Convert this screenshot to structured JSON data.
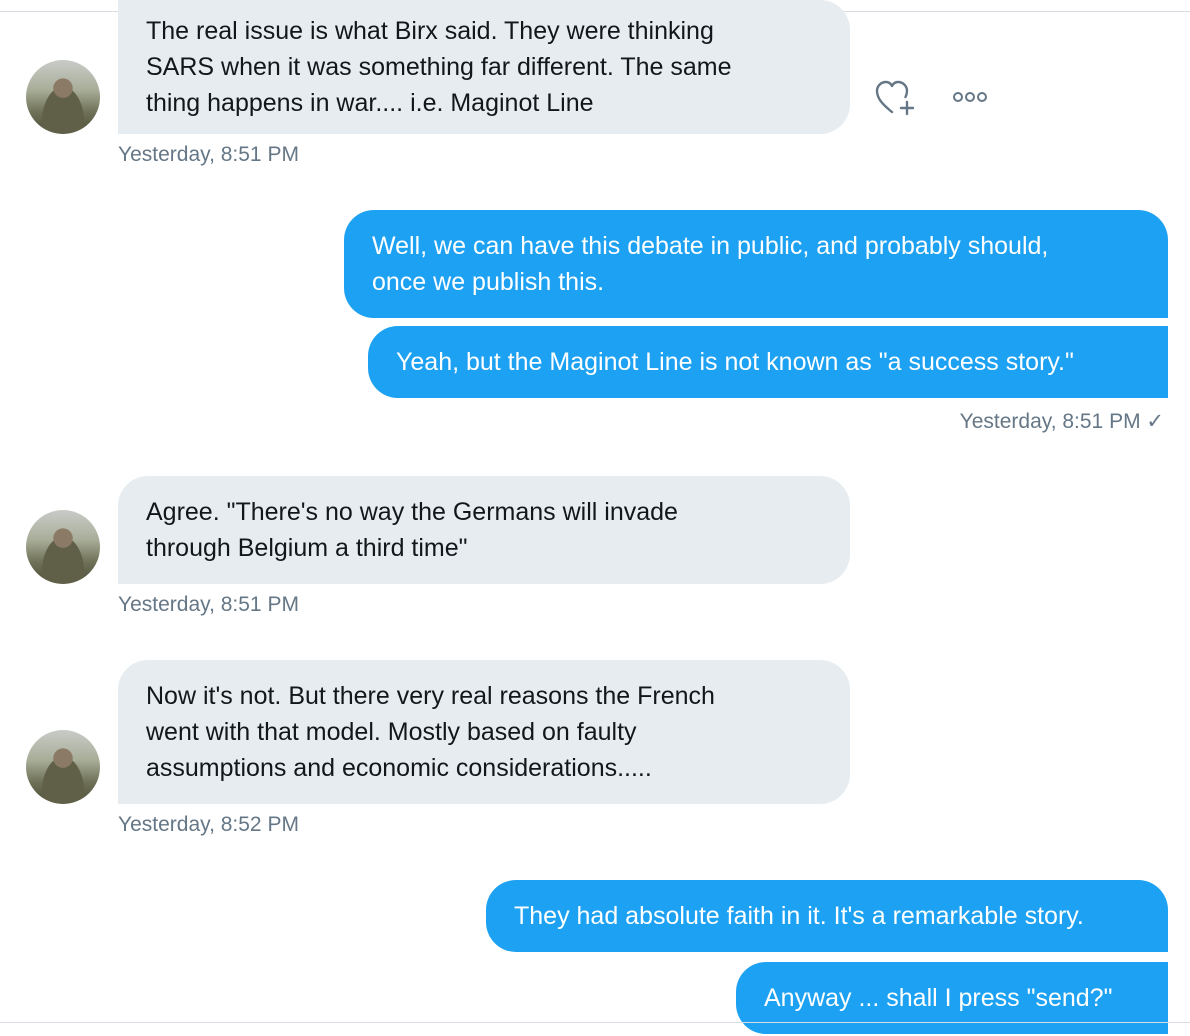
{
  "messages": {
    "m1": {
      "lines": [
        "The real issue is what Birx said.  They were thinking",
        "SARS when it was something far different.  The same",
        "thing happens in war.... i.e. Maginot Line"
      ],
      "time": "Yesterday, 8:51 PM"
    },
    "m2": {
      "lines": [
        "Well, we can have this debate in public, and probably should,",
        "once we publish this."
      ]
    },
    "m3": {
      "lines": [
        "Yeah, but the Maginot Line is not known as \"a success story.\""
      ],
      "time": "Yesterday, 8:51 PM ✓"
    },
    "m4": {
      "lines": [
        "Agree.  \"There's no way the Germans will invade",
        "through Belgium a third time\""
      ],
      "time": "Yesterday, 8:51 PM"
    },
    "m5": {
      "lines": [
        "Now it's not.  But there very real reasons the French",
        "went with that model.  Mostly based on faulty",
        "assumptions and economic considerations....."
      ],
      "time": "Yesterday, 8:52 PM"
    },
    "m6": {
      "lines": [
        "They had absolute faith in it. It's a remarkable story."
      ]
    },
    "m7": {
      "lines": [
        "Anyway ... shall I press \"send?\""
      ]
    }
  },
  "icons": {
    "like": "heart-plus-icon",
    "more": "more-options-icon"
  },
  "colors": {
    "incoming_bg": "#e6ecf0",
    "outgoing_bg": "#1da1f2",
    "meta_text": "#657786"
  }
}
